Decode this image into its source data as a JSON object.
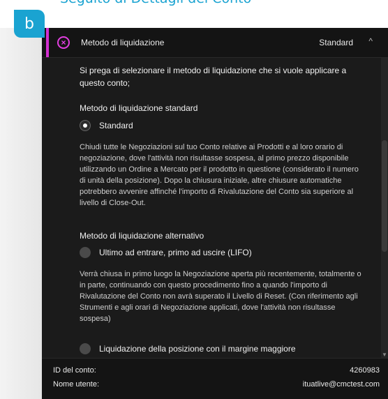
{
  "page_title": "Seguito di Dettagli del Conto",
  "step_badge": "b",
  "header": {
    "title": "Metodo di liquidazione",
    "value": "Standard",
    "chevron_icon": "chevron-up-icon",
    "close_icon": "close-icon"
  },
  "content": {
    "intro": "Si prega di selezionare il metodo di liquidazione che si vuole applicare a questo conto;",
    "standard": {
      "heading": "Metodo di liquidazione standard",
      "option_label": "Standard",
      "selected": true,
      "description": "Chiudi tutte le Negoziazioni sul tuo Conto relative ai Prodotti e al loro orario di negoziazione, dove l'attività non risultasse sospesa, al primo prezzo disponibile utilizzando un Ordine a Mercato per il prodotto in questione (considerato il numero di unità della posizione). Dopo la chiusura iniziale, altre chiusure automatiche potrebbero avvenire affinché l'importo di Rivalutazione del Conto sia superiore al livello di Close-Out."
    },
    "alternative": {
      "heading": "Metodo di liquidazione alternativo",
      "option_lifo_label": "Ultimo ad entrare, primo ad uscire (LIFO)",
      "lifo_selected": false,
      "lifo_description": "Verrà chiusa in primo luogo la Negoziazione aperta più recentemente, totalmente o in parte, continuando con questo procedimento fino a quando l'importo di Rivalutazione del Conto non avrà superato il Livello di Reset. (Con riferimento agli Strumenti e agli orari di Negoziazione applicati, dove l'attività non risultasse sospesa)",
      "option_margin_label": "Liquidazione della posizione con il margine maggiore",
      "margin_selected": false
    }
  },
  "footer": {
    "account_id_label": "ID del conto:",
    "account_id_value": "4260983",
    "username_label": "Nome utente:",
    "username_value": "ituatlive@cmctest.com"
  },
  "colors": {
    "accent": "#1aa3d1",
    "magenta": "#d32fd1",
    "panel_bg": "#1b1b1b"
  }
}
